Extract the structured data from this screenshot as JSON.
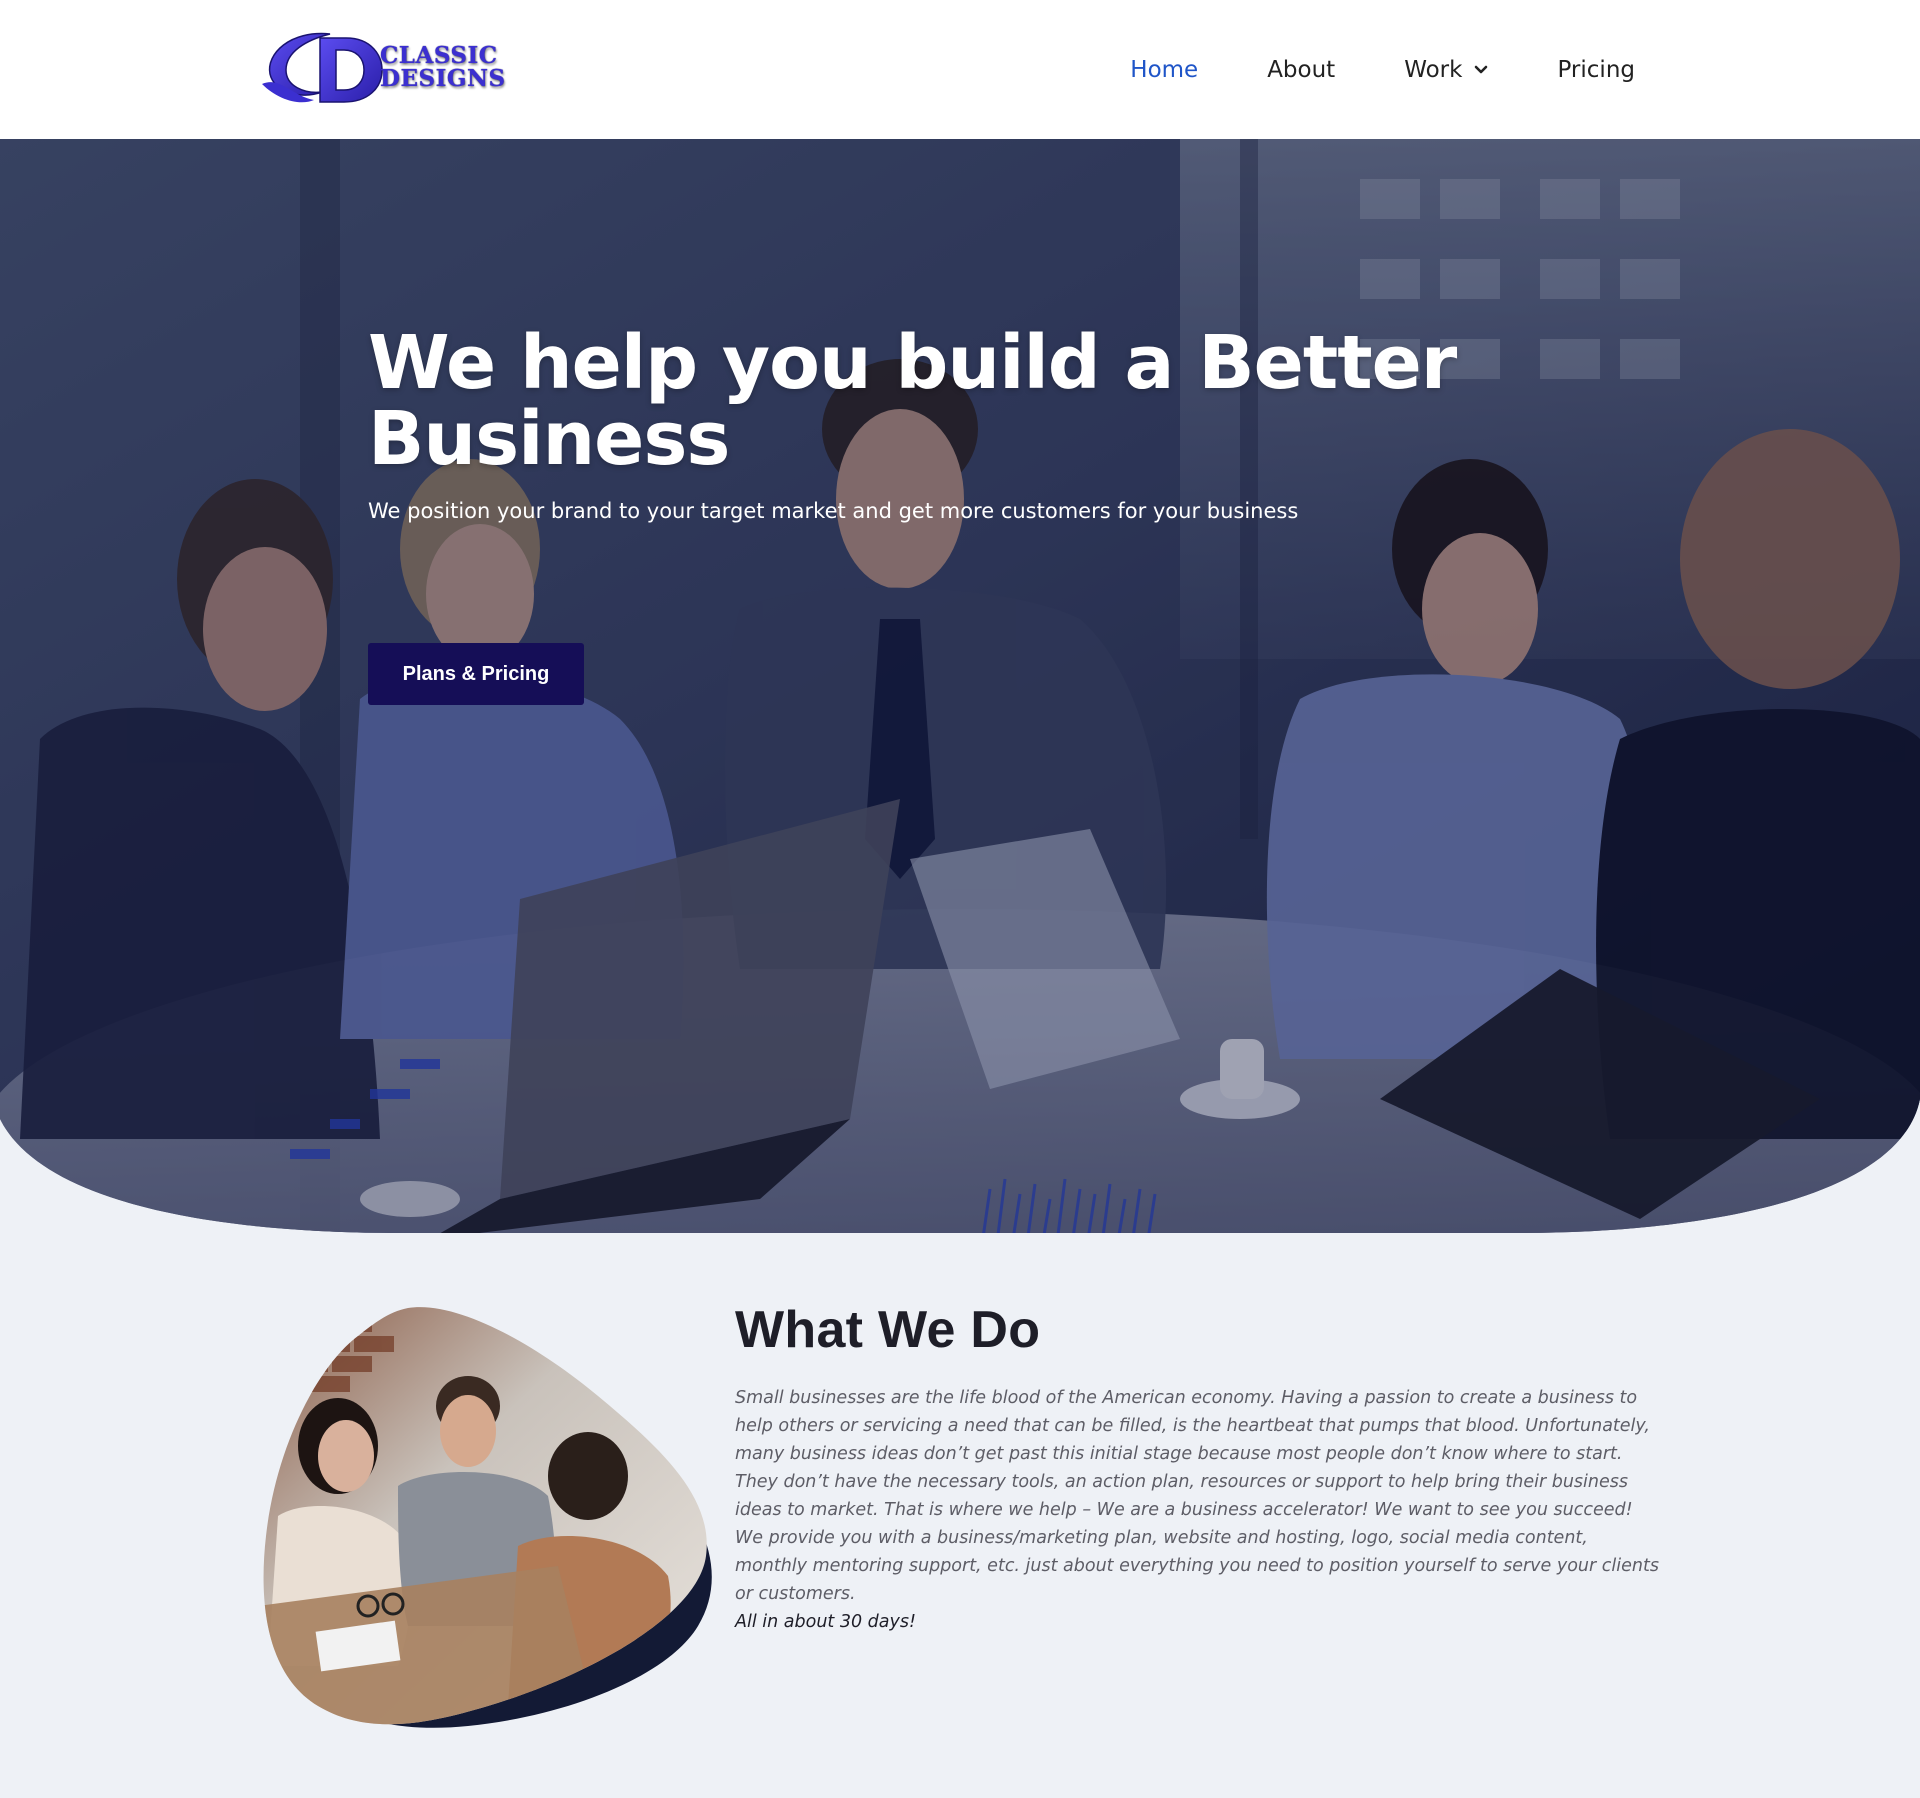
{
  "brand": {
    "logo_line1": "CLASSIC",
    "logo_line2": "DESIGNS",
    "logo_monogram": "CD",
    "accent": "#3b2fd0"
  },
  "nav": {
    "items": [
      {
        "label": "Home",
        "active": true
      },
      {
        "label": "About",
        "active": false
      },
      {
        "label": "Work",
        "active": false,
        "has_dropdown": true
      },
      {
        "label": "Pricing",
        "active": false
      }
    ],
    "active_color": "#1f55c8",
    "dropdown_icon": "chevron-down-icon"
  },
  "hero": {
    "title": "We help you build a Better Business",
    "subtitle": "We position your brand to your target market and get more customers for your business",
    "cta_label": "Plans & Pricing",
    "cta_color": "#150e57",
    "background": "business-meeting-photo"
  },
  "what_we_do": {
    "title": "What We Do",
    "body": "Small businesses are the life blood of the American economy. Having a passion to create a business to help others or servicing a need that can be filled, is the heartbeat that pumps that blood. Unfortunately, many business ideas don’t get past this initial stage because most people don’t know where to start. They don’t have the necessary tools, an action plan, resources or support to help bring their business ideas to market. That is where we help – We are a business accelerator! We want to see you succeed! We provide you with a business/marketing plan, website and hosting, logo, social media content, monthly mentoring support, etc. just about everything you need to position yourself to serve your clients or customers.",
    "closing": "All in about 30 days!",
    "image": "team-meeting-photo"
  }
}
